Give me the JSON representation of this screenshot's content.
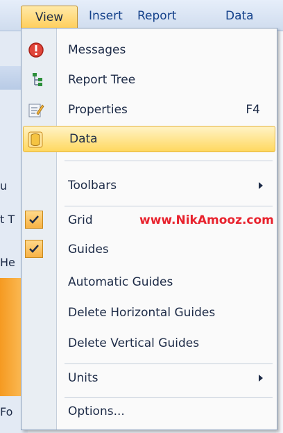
{
  "menubar": {
    "items": [
      "View",
      "Insert",
      "Report",
      "Data"
    ]
  },
  "background_fragments": [
    "u",
    "t T",
    "He",
    "Fo"
  ],
  "menu": {
    "items": [
      {
        "label": "Messages",
        "icon": "alert-icon"
      },
      {
        "label": "Report Tree",
        "icon": "tree-icon"
      },
      {
        "label": "Properties",
        "shortcut": "F4",
        "icon": "properties-icon"
      },
      {
        "label": "Data",
        "icon": "database-icon",
        "highlighted": true
      },
      {
        "label": "Toolbars",
        "submenu": true
      },
      {
        "label": "Grid",
        "checked": true
      },
      {
        "label": "Guides",
        "checked": true
      },
      {
        "label": "Automatic Guides"
      },
      {
        "label": "Delete Horizontal Guides"
      },
      {
        "label": "Delete Vertical Guides"
      },
      {
        "label": "Units",
        "submenu": true
      },
      {
        "label": "Options..."
      }
    ],
    "watermark": "www.NikAmooz.com"
  },
  "colors": {
    "highlight": "#ffd85f",
    "watermark": "#e8222d",
    "menu_text": "#1d2b47"
  }
}
